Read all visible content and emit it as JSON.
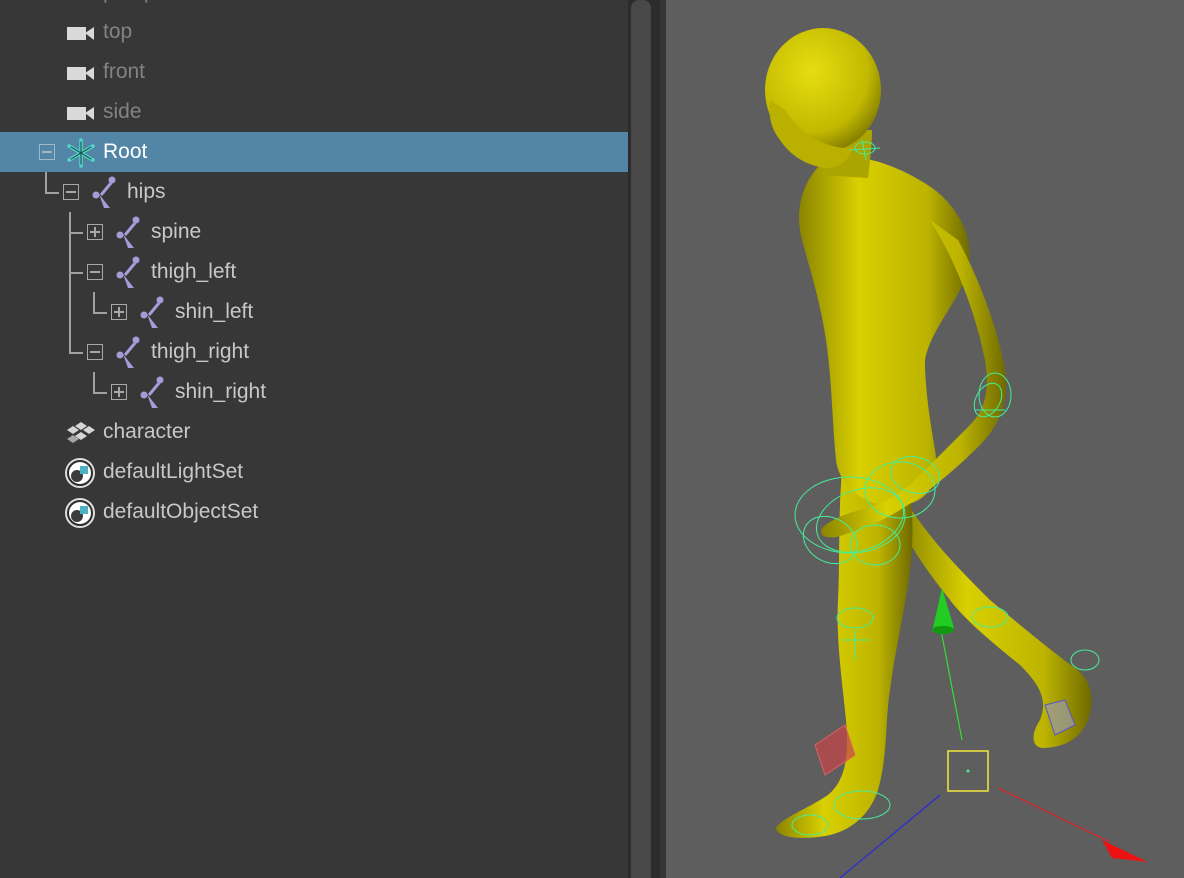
{
  "outliner": {
    "items": [
      {
        "label": "persp",
        "icon": "camera-icon"
      },
      {
        "label": "top",
        "icon": "camera-icon"
      },
      {
        "label": "front",
        "icon": "camera-icon"
      },
      {
        "label": "side",
        "icon": "camera-icon"
      },
      {
        "label": "Root",
        "icon": "locator-icon",
        "selected": true,
        "expanded": true
      },
      {
        "label": "hips",
        "icon": "joint-icon",
        "expanded": true
      },
      {
        "label": "spine",
        "icon": "joint-icon",
        "expanded": false
      },
      {
        "label": "thigh_left",
        "icon": "joint-icon",
        "expanded": true
      },
      {
        "label": "shin_left",
        "icon": "joint-icon",
        "expanded": false
      },
      {
        "label": "thigh_right",
        "icon": "joint-icon",
        "expanded": true
      },
      {
        "label": "shin_right",
        "icon": "joint-icon",
        "expanded": false
      },
      {
        "label": "character",
        "icon": "character-set-icon"
      },
      {
        "label": "defaultLightSet",
        "icon": "object-set-icon"
      },
      {
        "label": "defaultObjectSet",
        "icon": "object-set-icon"
      }
    ]
  },
  "viewport": {
    "content": "3d-character-with-rig",
    "colors": {
      "background": "#5e5e5e",
      "mesh": "#c8c000",
      "controls": "#44ee99",
      "selection": "#f2ea3a"
    }
  }
}
